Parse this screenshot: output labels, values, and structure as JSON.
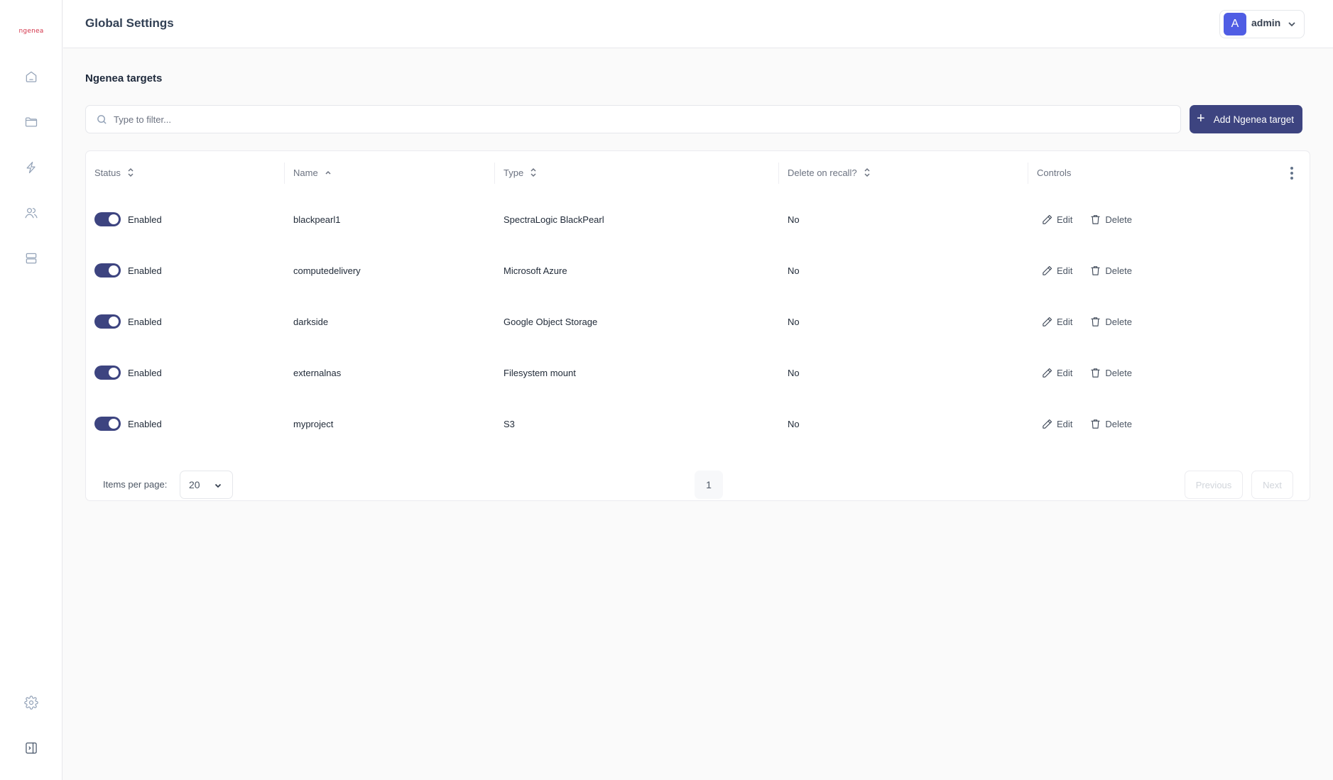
{
  "brand": {
    "logo_text": "ngenea",
    "accent": "#3d4480",
    "logo_color": "#d3344a"
  },
  "sidebar": {
    "items": [
      {
        "name": "home",
        "icon": "home-icon"
      },
      {
        "name": "files",
        "icon": "folder-icon"
      },
      {
        "name": "actions",
        "icon": "lightning-icon"
      },
      {
        "name": "users",
        "icon": "users-icon"
      },
      {
        "name": "servers",
        "icon": "server-icon"
      }
    ],
    "bottom": [
      {
        "name": "settings",
        "icon": "gear-icon"
      },
      {
        "name": "expand-sidebar",
        "icon": "sidebar-expand-icon"
      }
    ]
  },
  "header": {
    "title": "Global Settings",
    "user": {
      "initial": "A",
      "name": "admin"
    }
  },
  "section": {
    "title": "Ngenea targets"
  },
  "filter": {
    "placeholder": "Type to filter...",
    "value": ""
  },
  "add_button": {
    "label": "Add Ngenea target"
  },
  "table": {
    "columns": [
      {
        "label": "Status",
        "sort": "none"
      },
      {
        "label": "Name",
        "sort": "asc"
      },
      {
        "label": "Type",
        "sort": "none"
      },
      {
        "label": "Delete on recall?",
        "sort": "none"
      },
      {
        "label": "Controls",
        "sort": null
      }
    ],
    "rows": [
      {
        "enabled": true,
        "status": "Enabled",
        "name": "blackpearl1",
        "type": "SpectraLogic BlackPearl",
        "delete_on_recall": "No"
      },
      {
        "enabled": true,
        "status": "Enabled",
        "name": "computedelivery",
        "type": "Microsoft Azure",
        "delete_on_recall": "No"
      },
      {
        "enabled": true,
        "status": "Enabled",
        "name": "darkside",
        "type": "Google Object Storage",
        "delete_on_recall": "No"
      },
      {
        "enabled": true,
        "status": "Enabled",
        "name": "externalnas",
        "type": "Filesystem mount",
        "delete_on_recall": "No"
      },
      {
        "enabled": true,
        "status": "Enabled",
        "name": "myproject",
        "type": "S3",
        "delete_on_recall": "No"
      }
    ],
    "controls": {
      "edit": "Edit",
      "delete": "Delete"
    }
  },
  "pagination": {
    "items_per_page_label": "Items per page:",
    "items_per_page": "20",
    "current_page": "1",
    "previous": "Previous",
    "next": "Next"
  }
}
